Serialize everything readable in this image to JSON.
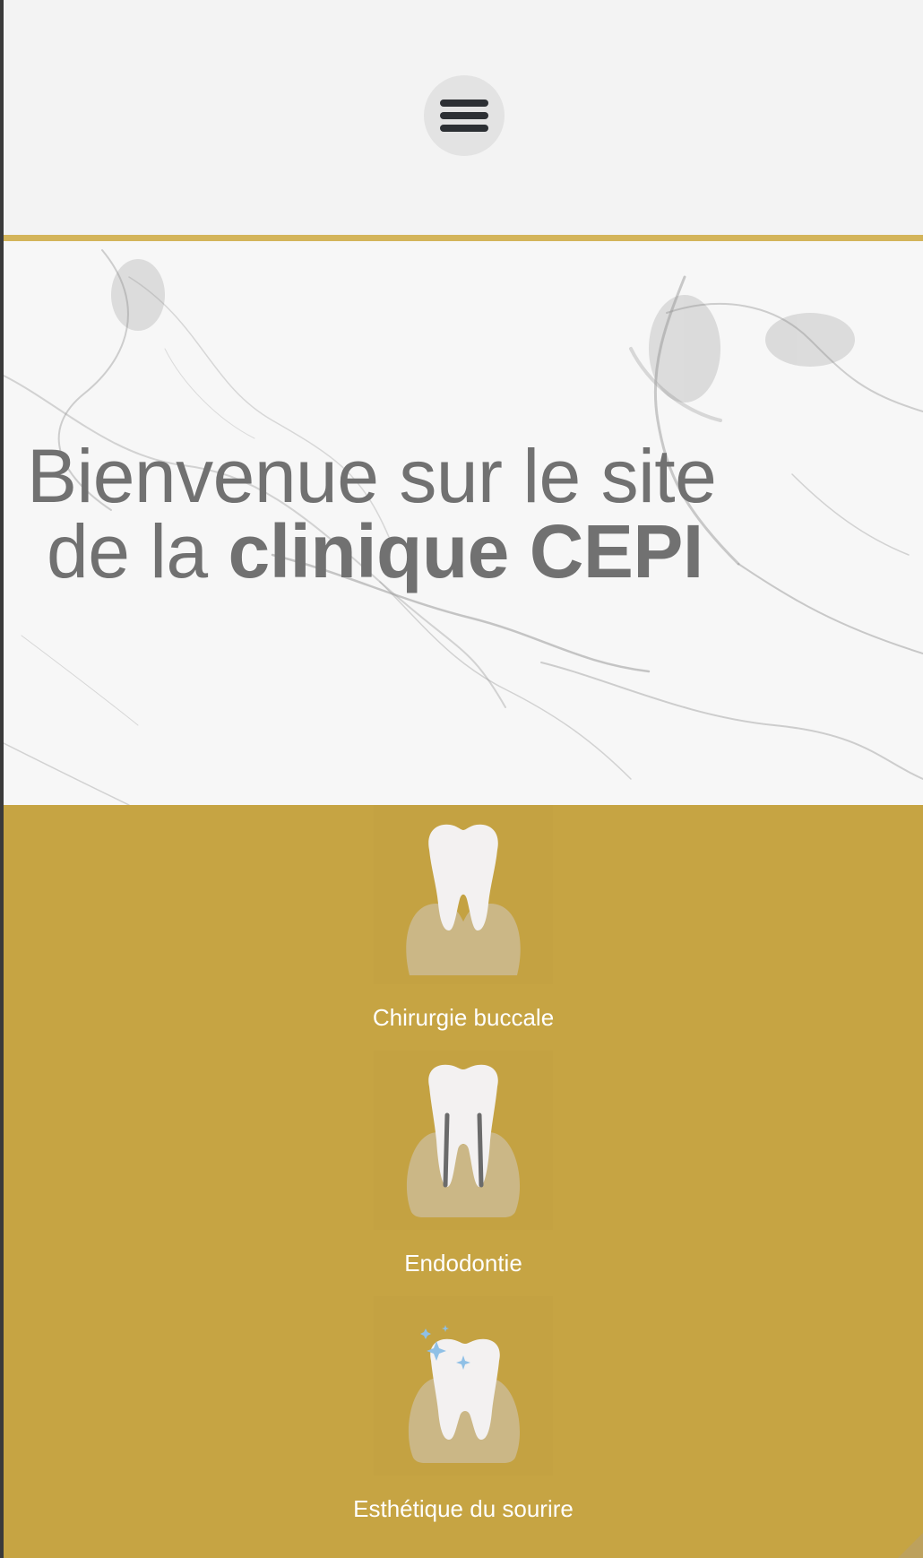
{
  "header": {
    "menu_icon": "hamburger-menu-icon"
  },
  "hero": {
    "title_line1": "Bienvenue sur le site",
    "title_line2_prefix": "de la ",
    "title_line2_bold": "clinique CEPI"
  },
  "services": [
    {
      "label": "Chirurgie buccale",
      "icon": "tooth-gum-surgery-icon"
    },
    {
      "label": "Endodontie",
      "icon": "tooth-root-canal-icon"
    },
    {
      "label": "Esthétique du sourire",
      "icon": "sparkling-tooth-icon"
    }
  ],
  "colors": {
    "accent_gold": "#c6a443",
    "rule_gold": "#d3b45a",
    "title_gray": "#717171",
    "gum": "#cbb786",
    "tooth": "#f3f1f1",
    "sparkle": "#8fc0e6"
  }
}
